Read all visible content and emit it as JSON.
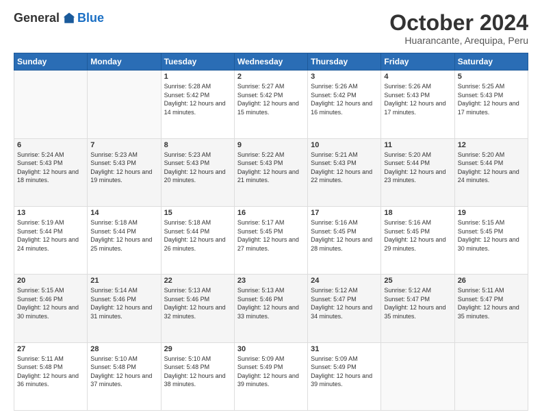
{
  "logo": {
    "general": "General",
    "blue": "Blue"
  },
  "header": {
    "title": "October 2024",
    "subtitle": "Huarancante, Arequipa, Peru"
  },
  "weekdays": [
    "Sunday",
    "Monday",
    "Tuesday",
    "Wednesday",
    "Thursday",
    "Friday",
    "Saturday"
  ],
  "weeks": [
    [
      {
        "day": "",
        "sunrise": "",
        "sunset": "",
        "daylight": ""
      },
      {
        "day": "",
        "sunrise": "",
        "sunset": "",
        "daylight": ""
      },
      {
        "day": "1",
        "sunrise": "Sunrise: 5:28 AM",
        "sunset": "Sunset: 5:42 PM",
        "daylight": "Daylight: 12 hours and 14 minutes."
      },
      {
        "day": "2",
        "sunrise": "Sunrise: 5:27 AM",
        "sunset": "Sunset: 5:42 PM",
        "daylight": "Daylight: 12 hours and 15 minutes."
      },
      {
        "day": "3",
        "sunrise": "Sunrise: 5:26 AM",
        "sunset": "Sunset: 5:42 PM",
        "daylight": "Daylight: 12 hours and 16 minutes."
      },
      {
        "day": "4",
        "sunrise": "Sunrise: 5:26 AM",
        "sunset": "Sunset: 5:43 PM",
        "daylight": "Daylight: 12 hours and 17 minutes."
      },
      {
        "day": "5",
        "sunrise": "Sunrise: 5:25 AM",
        "sunset": "Sunset: 5:43 PM",
        "daylight": "Daylight: 12 hours and 17 minutes."
      }
    ],
    [
      {
        "day": "6",
        "sunrise": "Sunrise: 5:24 AM",
        "sunset": "Sunset: 5:43 PM",
        "daylight": "Daylight: 12 hours and 18 minutes."
      },
      {
        "day": "7",
        "sunrise": "Sunrise: 5:23 AM",
        "sunset": "Sunset: 5:43 PM",
        "daylight": "Daylight: 12 hours and 19 minutes."
      },
      {
        "day": "8",
        "sunrise": "Sunrise: 5:23 AM",
        "sunset": "Sunset: 5:43 PM",
        "daylight": "Daylight: 12 hours and 20 minutes."
      },
      {
        "day": "9",
        "sunrise": "Sunrise: 5:22 AM",
        "sunset": "Sunset: 5:43 PM",
        "daylight": "Daylight: 12 hours and 21 minutes."
      },
      {
        "day": "10",
        "sunrise": "Sunrise: 5:21 AM",
        "sunset": "Sunset: 5:43 PM",
        "daylight": "Daylight: 12 hours and 22 minutes."
      },
      {
        "day": "11",
        "sunrise": "Sunrise: 5:20 AM",
        "sunset": "Sunset: 5:44 PM",
        "daylight": "Daylight: 12 hours and 23 minutes."
      },
      {
        "day": "12",
        "sunrise": "Sunrise: 5:20 AM",
        "sunset": "Sunset: 5:44 PM",
        "daylight": "Daylight: 12 hours and 24 minutes."
      }
    ],
    [
      {
        "day": "13",
        "sunrise": "Sunrise: 5:19 AM",
        "sunset": "Sunset: 5:44 PM",
        "daylight": "Daylight: 12 hours and 24 minutes."
      },
      {
        "day": "14",
        "sunrise": "Sunrise: 5:18 AM",
        "sunset": "Sunset: 5:44 PM",
        "daylight": "Daylight: 12 hours and 25 minutes."
      },
      {
        "day": "15",
        "sunrise": "Sunrise: 5:18 AM",
        "sunset": "Sunset: 5:44 PM",
        "daylight": "Daylight: 12 hours and 26 minutes."
      },
      {
        "day": "16",
        "sunrise": "Sunrise: 5:17 AM",
        "sunset": "Sunset: 5:45 PM",
        "daylight": "Daylight: 12 hours and 27 minutes."
      },
      {
        "day": "17",
        "sunrise": "Sunrise: 5:16 AM",
        "sunset": "Sunset: 5:45 PM",
        "daylight": "Daylight: 12 hours and 28 minutes."
      },
      {
        "day": "18",
        "sunrise": "Sunrise: 5:16 AM",
        "sunset": "Sunset: 5:45 PM",
        "daylight": "Daylight: 12 hours and 29 minutes."
      },
      {
        "day": "19",
        "sunrise": "Sunrise: 5:15 AM",
        "sunset": "Sunset: 5:45 PM",
        "daylight": "Daylight: 12 hours and 30 minutes."
      }
    ],
    [
      {
        "day": "20",
        "sunrise": "Sunrise: 5:15 AM",
        "sunset": "Sunset: 5:46 PM",
        "daylight": "Daylight: 12 hours and 30 minutes."
      },
      {
        "day": "21",
        "sunrise": "Sunrise: 5:14 AM",
        "sunset": "Sunset: 5:46 PM",
        "daylight": "Daylight: 12 hours and 31 minutes."
      },
      {
        "day": "22",
        "sunrise": "Sunrise: 5:13 AM",
        "sunset": "Sunset: 5:46 PM",
        "daylight": "Daylight: 12 hours and 32 minutes."
      },
      {
        "day": "23",
        "sunrise": "Sunrise: 5:13 AM",
        "sunset": "Sunset: 5:46 PM",
        "daylight": "Daylight: 12 hours and 33 minutes."
      },
      {
        "day": "24",
        "sunrise": "Sunrise: 5:12 AM",
        "sunset": "Sunset: 5:47 PM",
        "daylight": "Daylight: 12 hours and 34 minutes."
      },
      {
        "day": "25",
        "sunrise": "Sunrise: 5:12 AM",
        "sunset": "Sunset: 5:47 PM",
        "daylight": "Daylight: 12 hours and 35 minutes."
      },
      {
        "day": "26",
        "sunrise": "Sunrise: 5:11 AM",
        "sunset": "Sunset: 5:47 PM",
        "daylight": "Daylight: 12 hours and 35 minutes."
      }
    ],
    [
      {
        "day": "27",
        "sunrise": "Sunrise: 5:11 AM",
        "sunset": "Sunset: 5:48 PM",
        "daylight": "Daylight: 12 hours and 36 minutes."
      },
      {
        "day": "28",
        "sunrise": "Sunrise: 5:10 AM",
        "sunset": "Sunset: 5:48 PM",
        "daylight": "Daylight: 12 hours and 37 minutes."
      },
      {
        "day": "29",
        "sunrise": "Sunrise: 5:10 AM",
        "sunset": "Sunset: 5:48 PM",
        "daylight": "Daylight: 12 hours and 38 minutes."
      },
      {
        "day": "30",
        "sunrise": "Sunrise: 5:09 AM",
        "sunset": "Sunset: 5:49 PM",
        "daylight": "Daylight: 12 hours and 39 minutes."
      },
      {
        "day": "31",
        "sunrise": "Sunrise: 5:09 AM",
        "sunset": "Sunset: 5:49 PM",
        "daylight": "Daylight: 12 hours and 39 minutes."
      },
      {
        "day": "",
        "sunrise": "",
        "sunset": "",
        "daylight": ""
      },
      {
        "day": "",
        "sunrise": "",
        "sunset": "",
        "daylight": ""
      }
    ]
  ]
}
